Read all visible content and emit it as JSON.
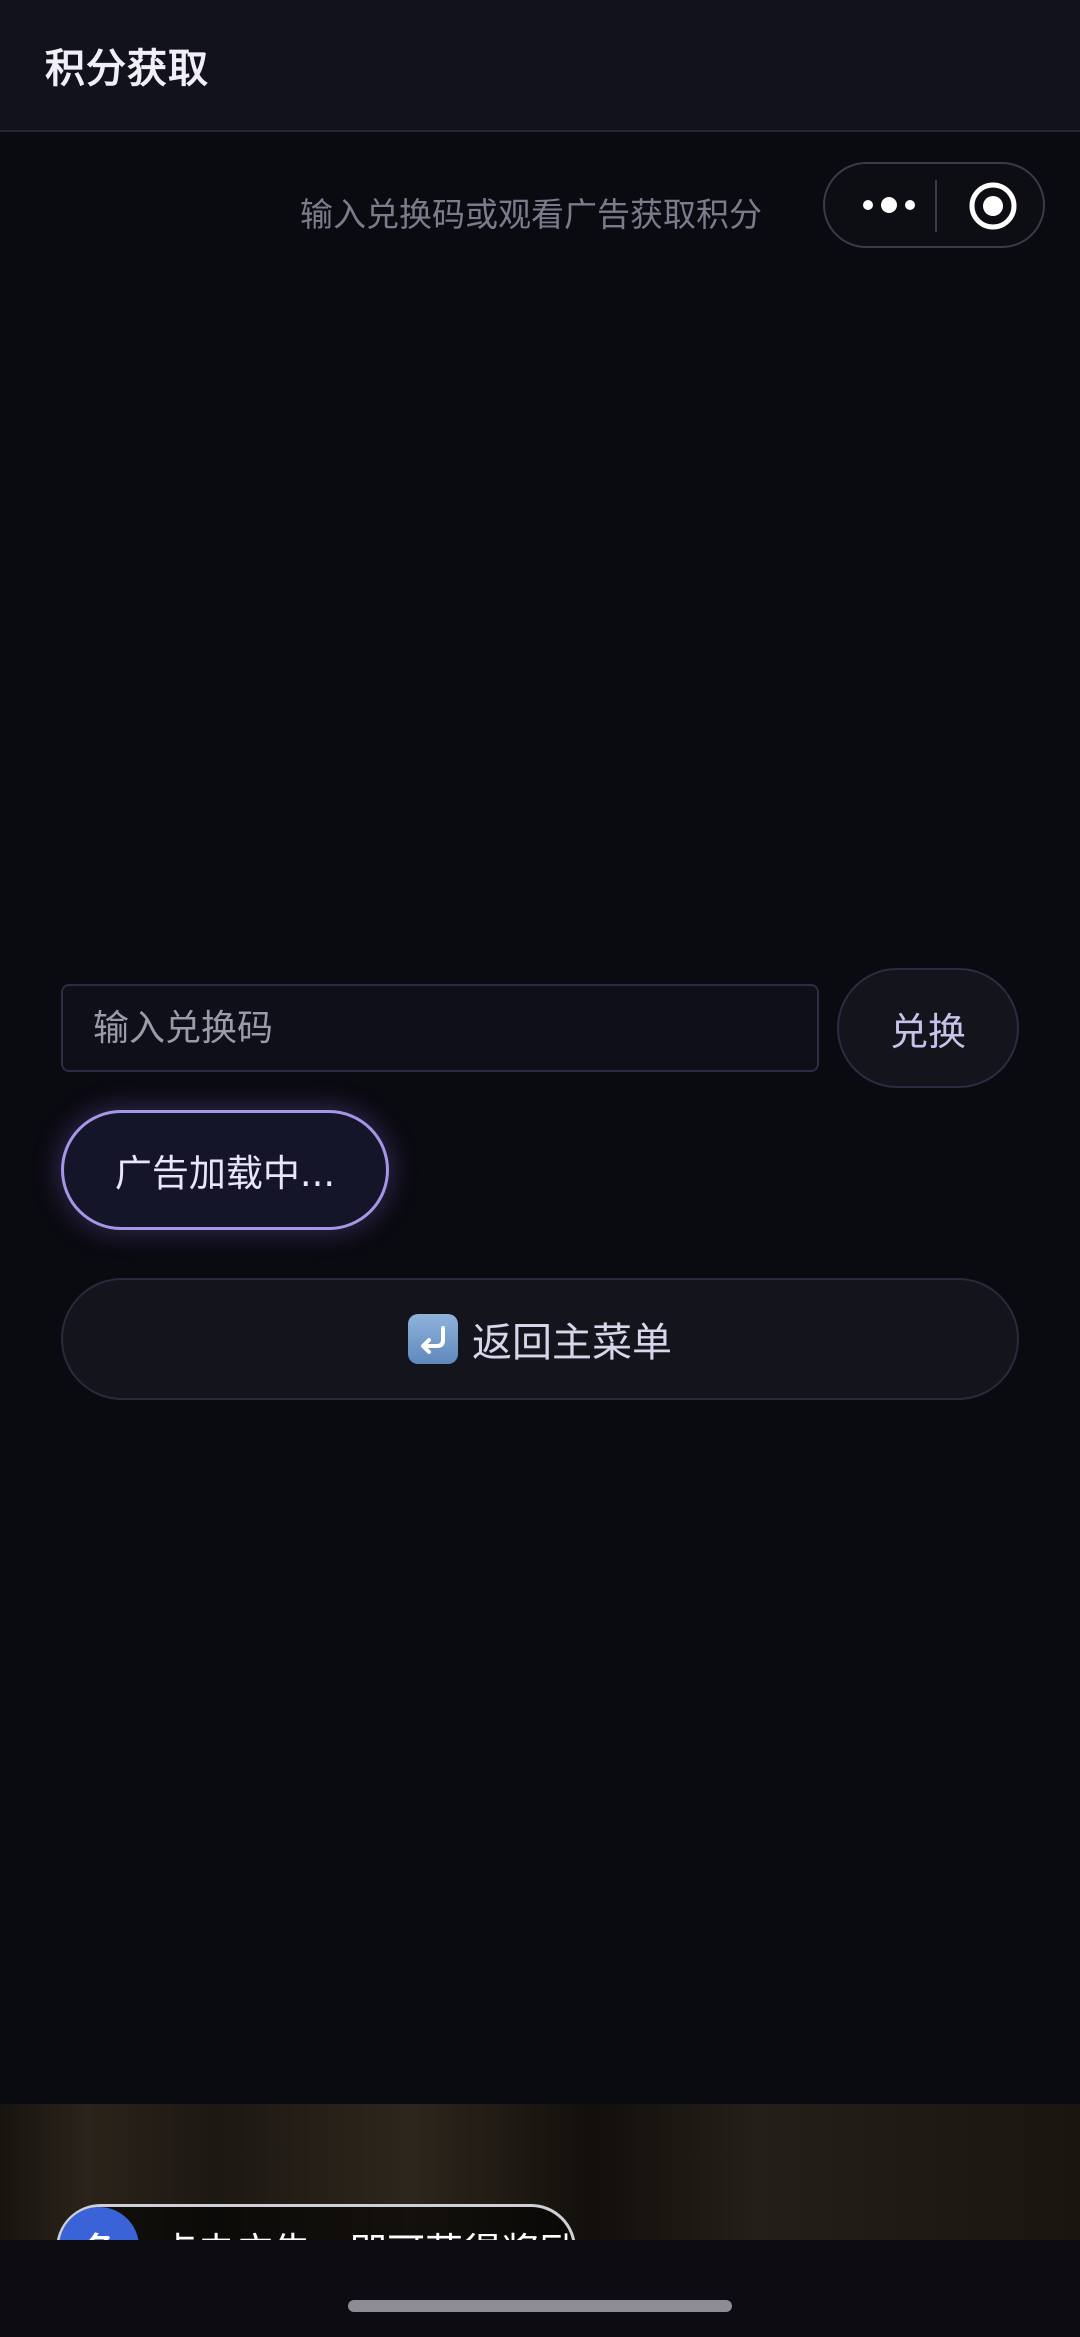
{
  "header": {
    "title": "积分获取"
  },
  "subtitle": "输入兑换码或观看广告获取积分",
  "capsule": {
    "more_icon": "more-dots-icon",
    "close_icon": "target-close-icon"
  },
  "redeem": {
    "placeholder": "输入兑换码",
    "value": "",
    "button_label": "兑换"
  },
  "ad_button": {
    "label": "广告加载中..."
  },
  "back_button": {
    "icon": "return-arrow-icon",
    "label": "返回主菜单"
  },
  "ad_banner": {
    "badge_text": "冬",
    "text": "点击广告，即可获得奖励"
  },
  "colors": {
    "background": "#0a0a11",
    "accent": "#a795e8",
    "ad_badge": "#3a63d8"
  }
}
